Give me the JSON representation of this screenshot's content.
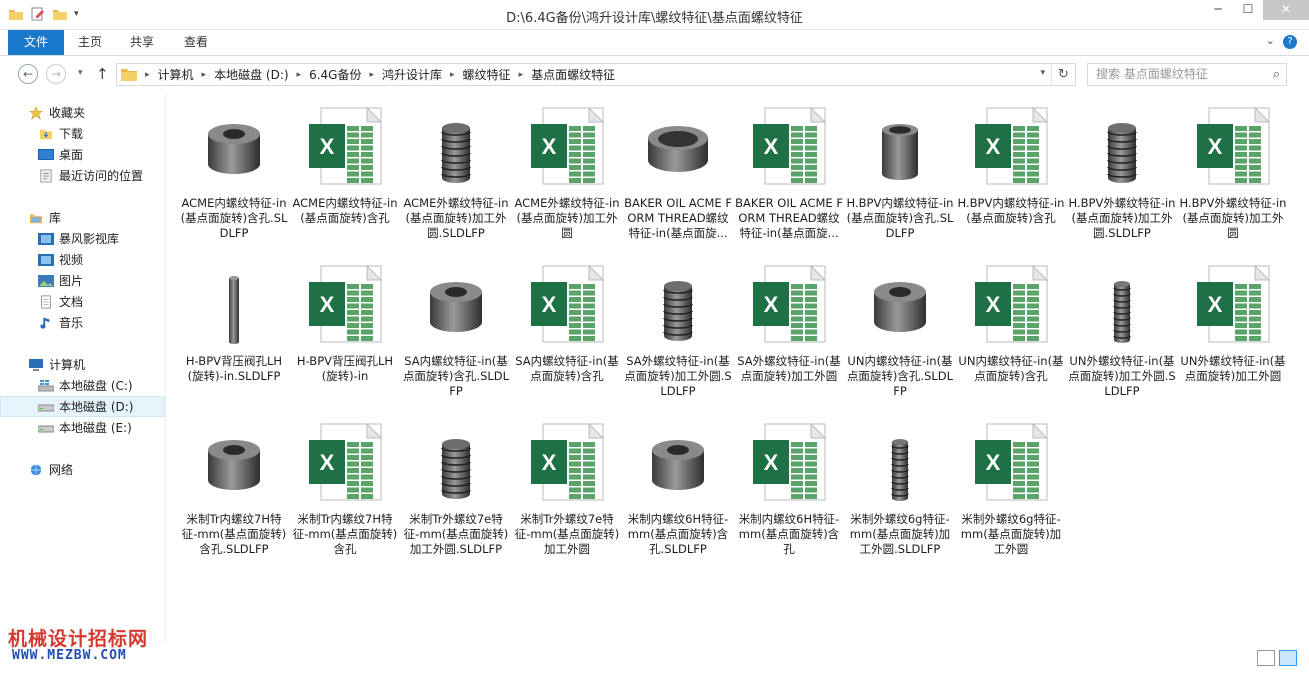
{
  "window": {
    "title": "D:\\6.4G备份\\鸿升设计库\\螺纹特征\\基点面螺纹特征",
    "minimize": "─",
    "maximize": "☐",
    "close": "✕"
  },
  "ribbon": {
    "tabs": [
      "文件",
      "主页",
      "共享",
      "查看"
    ],
    "help": "?"
  },
  "address": {
    "breadcrumbs": [
      "计算机",
      "本地磁盘 (D:)",
      "6.4G备份",
      "鸿升设计库",
      "螺纹特征",
      "基点面螺纹特征"
    ],
    "search_placeholder": "搜索 基点面螺纹特征"
  },
  "nav": {
    "favorites_header": "收藏夹",
    "favorites": [
      "下载",
      "桌面",
      "最近访问的位置"
    ],
    "libraries_header": "库",
    "libraries": [
      "暴风影视库",
      "视频",
      "图片",
      "文档",
      "音乐"
    ],
    "computer_header": "计算机",
    "drives": [
      "本地磁盘 (C:)",
      "本地磁盘 (D:)",
      "本地磁盘 (E:)"
    ],
    "selected_drive": "本地磁盘 (D:)",
    "network": "网络"
  },
  "files": [
    {
      "name": "ACME内螺纹特征-in(基点面旋转)含孔.SLDLFP",
      "kind": "part",
      "shape": "nut"
    },
    {
      "name": "ACME内螺纹特征-in(基点面旋转)含孔",
      "kind": "excel"
    },
    {
      "name": "ACME外螺纹特征-in(基点面旋转)加工外圆.SLDLFP",
      "kind": "part",
      "shape": "bolt"
    },
    {
      "name": "ACME外螺纹特征-in(基点面旋转)加工外圆",
      "kind": "excel"
    },
    {
      "name": "BAKER OIL ACME FORM THREAD螺纹特征-in(基点面旋...",
      "kind": "part",
      "shape": "ring"
    },
    {
      "name": "BAKER OIL ACME FORM THREAD螺纹特征-in(基点面旋...",
      "kind": "excel"
    },
    {
      "name": "H.BPV内螺纹特征-in(基点面旋转)含孔.SLDLFP",
      "kind": "part",
      "shape": "sleeve"
    },
    {
      "name": "H.BPV内螺纹特征-in(基点面旋转)含孔",
      "kind": "excel"
    },
    {
      "name": "H.BPV外螺纹特征-in(基点面旋转)加工外圆.SLDLFP",
      "kind": "part",
      "shape": "bolt"
    },
    {
      "name": "H.BPV外螺纹特征-in(基点面旋转)加工外圆",
      "kind": "excel"
    },
    {
      "name": "H-BPV背压阀孔LH(旋转)-in.SLDLFP",
      "kind": "part",
      "shape": "rod"
    },
    {
      "name": "H-BPV背压阀孔LH(旋转)-in",
      "kind": "excel"
    },
    {
      "name": "SA内螺纹特征-in(基点面旋转)含孔.SLDLFP",
      "kind": "part",
      "shape": "nut"
    },
    {
      "name": "SA内螺纹特征-in(基点面旋转)含孔",
      "kind": "excel"
    },
    {
      "name": "SA外螺纹特征-in(基点面旋转)加工外圆.SLDLFP",
      "kind": "part",
      "shape": "bolt"
    },
    {
      "name": "SA外螺纹特征-in(基点面旋转)加工外圆",
      "kind": "excel"
    },
    {
      "name": "UN内螺纹特征-in(基点面旋转)含孔.SLDLFP",
      "kind": "part",
      "shape": "nut"
    },
    {
      "name": "UN内螺纹特征-in(基点面旋转)含孔",
      "kind": "excel"
    },
    {
      "name": "UN外螺纹特征-in(基点面旋转)加工外圆.SLDLFP",
      "kind": "part",
      "shape": "screw"
    },
    {
      "name": "UN外螺纹特征-in(基点面旋转)加工外圆",
      "kind": "excel"
    },
    {
      "name": "米制Tr内螺纹7H特征-mm(基点面旋转)含孔.SLDLFP",
      "kind": "part",
      "shape": "nut"
    },
    {
      "name": "米制Tr内螺纹7H特征-mm(基点面旋转)含孔",
      "kind": "excel"
    },
    {
      "name": "米制Tr外螺纹7e特征-mm(基点面旋转)加工外圆.SLDLFP",
      "kind": "part",
      "shape": "bolt"
    },
    {
      "name": "米制Tr外螺纹7e特征-mm(基点面旋转)加工外圆",
      "kind": "excel"
    },
    {
      "name": "米制内螺纹6H特征-mm(基点面旋转)含孔.SLDLFP",
      "kind": "part",
      "shape": "nut"
    },
    {
      "name": "米制内螺纹6H特征-mm(基点面旋转)含孔",
      "kind": "excel"
    },
    {
      "name": "米制外螺纹6g特征-mm(基点面旋转)加工外圆.SLDLFP",
      "kind": "part",
      "shape": "screw"
    },
    {
      "name": "米制外螺纹6g特征-mm(基点面旋转)加工外圆",
      "kind": "excel"
    }
  ],
  "watermark": {
    "line1": "机械设计招标网",
    "line2": "WWW.MEZBW.COM"
  },
  "colors": {
    "accent": "#1979ca",
    "excel_green": "#1e7145",
    "selected_bg": "#e5f3fb"
  }
}
